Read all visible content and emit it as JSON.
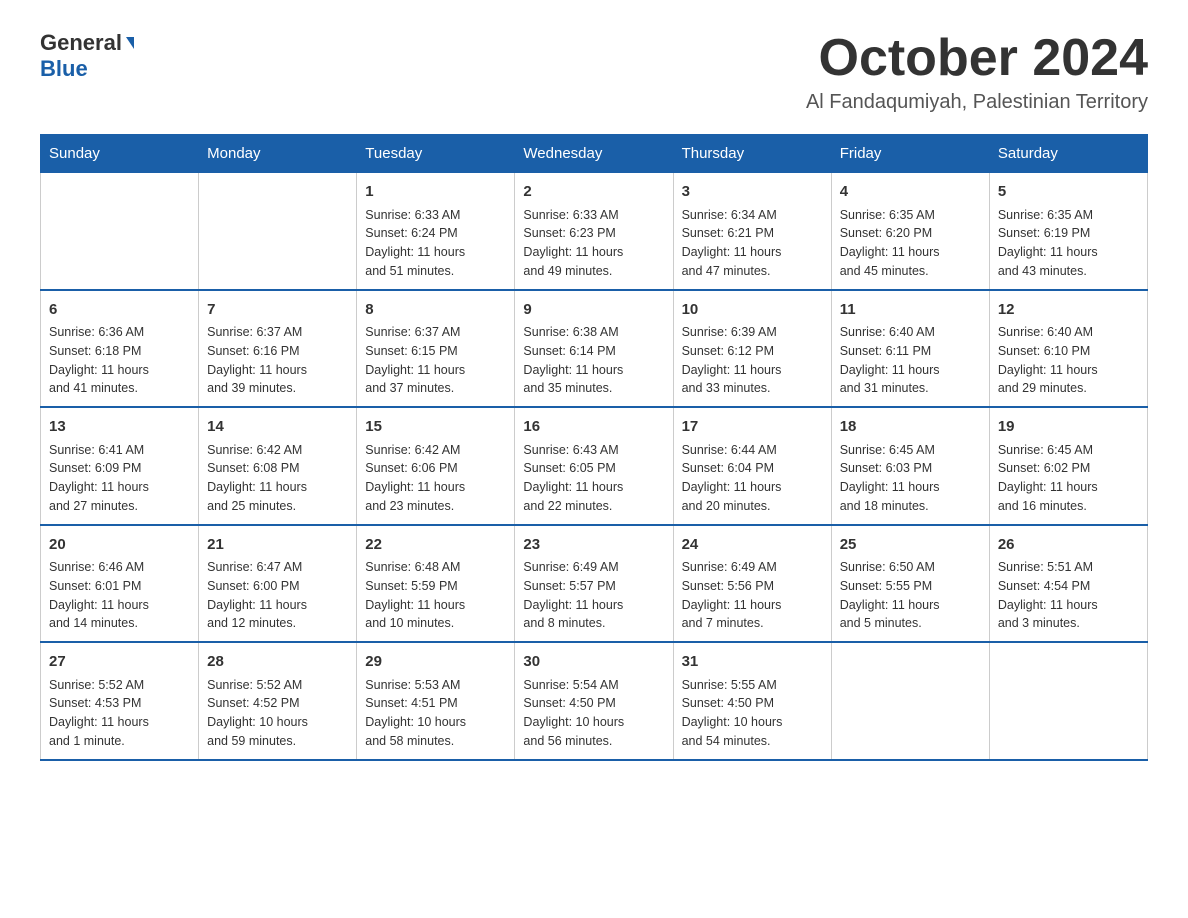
{
  "header": {
    "logo_general": "General",
    "logo_blue": "Blue",
    "month_title": "October 2024",
    "location": "Al Fandaqumiyah, Palestinian Territory"
  },
  "weekdays": [
    "Sunday",
    "Monday",
    "Tuesday",
    "Wednesday",
    "Thursday",
    "Friday",
    "Saturday"
  ],
  "weeks": [
    [
      {
        "day": "",
        "info": ""
      },
      {
        "day": "",
        "info": ""
      },
      {
        "day": "1",
        "info": "Sunrise: 6:33 AM\nSunset: 6:24 PM\nDaylight: 11 hours\nand 51 minutes."
      },
      {
        "day": "2",
        "info": "Sunrise: 6:33 AM\nSunset: 6:23 PM\nDaylight: 11 hours\nand 49 minutes."
      },
      {
        "day": "3",
        "info": "Sunrise: 6:34 AM\nSunset: 6:21 PM\nDaylight: 11 hours\nand 47 minutes."
      },
      {
        "day": "4",
        "info": "Sunrise: 6:35 AM\nSunset: 6:20 PM\nDaylight: 11 hours\nand 45 minutes."
      },
      {
        "day": "5",
        "info": "Sunrise: 6:35 AM\nSunset: 6:19 PM\nDaylight: 11 hours\nand 43 minutes."
      }
    ],
    [
      {
        "day": "6",
        "info": "Sunrise: 6:36 AM\nSunset: 6:18 PM\nDaylight: 11 hours\nand 41 minutes."
      },
      {
        "day": "7",
        "info": "Sunrise: 6:37 AM\nSunset: 6:16 PM\nDaylight: 11 hours\nand 39 minutes."
      },
      {
        "day": "8",
        "info": "Sunrise: 6:37 AM\nSunset: 6:15 PM\nDaylight: 11 hours\nand 37 minutes."
      },
      {
        "day": "9",
        "info": "Sunrise: 6:38 AM\nSunset: 6:14 PM\nDaylight: 11 hours\nand 35 minutes."
      },
      {
        "day": "10",
        "info": "Sunrise: 6:39 AM\nSunset: 6:12 PM\nDaylight: 11 hours\nand 33 minutes."
      },
      {
        "day": "11",
        "info": "Sunrise: 6:40 AM\nSunset: 6:11 PM\nDaylight: 11 hours\nand 31 minutes."
      },
      {
        "day": "12",
        "info": "Sunrise: 6:40 AM\nSunset: 6:10 PM\nDaylight: 11 hours\nand 29 minutes."
      }
    ],
    [
      {
        "day": "13",
        "info": "Sunrise: 6:41 AM\nSunset: 6:09 PM\nDaylight: 11 hours\nand 27 minutes."
      },
      {
        "day": "14",
        "info": "Sunrise: 6:42 AM\nSunset: 6:08 PM\nDaylight: 11 hours\nand 25 minutes."
      },
      {
        "day": "15",
        "info": "Sunrise: 6:42 AM\nSunset: 6:06 PM\nDaylight: 11 hours\nand 23 minutes."
      },
      {
        "day": "16",
        "info": "Sunrise: 6:43 AM\nSunset: 6:05 PM\nDaylight: 11 hours\nand 22 minutes."
      },
      {
        "day": "17",
        "info": "Sunrise: 6:44 AM\nSunset: 6:04 PM\nDaylight: 11 hours\nand 20 minutes."
      },
      {
        "day": "18",
        "info": "Sunrise: 6:45 AM\nSunset: 6:03 PM\nDaylight: 11 hours\nand 18 minutes."
      },
      {
        "day": "19",
        "info": "Sunrise: 6:45 AM\nSunset: 6:02 PM\nDaylight: 11 hours\nand 16 minutes."
      }
    ],
    [
      {
        "day": "20",
        "info": "Sunrise: 6:46 AM\nSunset: 6:01 PM\nDaylight: 11 hours\nand 14 minutes."
      },
      {
        "day": "21",
        "info": "Sunrise: 6:47 AM\nSunset: 6:00 PM\nDaylight: 11 hours\nand 12 minutes."
      },
      {
        "day": "22",
        "info": "Sunrise: 6:48 AM\nSunset: 5:59 PM\nDaylight: 11 hours\nand 10 minutes."
      },
      {
        "day": "23",
        "info": "Sunrise: 6:49 AM\nSunset: 5:57 PM\nDaylight: 11 hours\nand 8 minutes."
      },
      {
        "day": "24",
        "info": "Sunrise: 6:49 AM\nSunset: 5:56 PM\nDaylight: 11 hours\nand 7 minutes."
      },
      {
        "day": "25",
        "info": "Sunrise: 6:50 AM\nSunset: 5:55 PM\nDaylight: 11 hours\nand 5 minutes."
      },
      {
        "day": "26",
        "info": "Sunrise: 5:51 AM\nSunset: 4:54 PM\nDaylight: 11 hours\nand 3 minutes."
      }
    ],
    [
      {
        "day": "27",
        "info": "Sunrise: 5:52 AM\nSunset: 4:53 PM\nDaylight: 11 hours\nand 1 minute."
      },
      {
        "day": "28",
        "info": "Sunrise: 5:52 AM\nSunset: 4:52 PM\nDaylight: 10 hours\nand 59 minutes."
      },
      {
        "day": "29",
        "info": "Sunrise: 5:53 AM\nSunset: 4:51 PM\nDaylight: 10 hours\nand 58 minutes."
      },
      {
        "day": "30",
        "info": "Sunrise: 5:54 AM\nSunset: 4:50 PM\nDaylight: 10 hours\nand 56 minutes."
      },
      {
        "day": "31",
        "info": "Sunrise: 5:55 AM\nSunset: 4:50 PM\nDaylight: 10 hours\nand 54 minutes."
      },
      {
        "day": "",
        "info": ""
      },
      {
        "day": "",
        "info": ""
      }
    ]
  ]
}
